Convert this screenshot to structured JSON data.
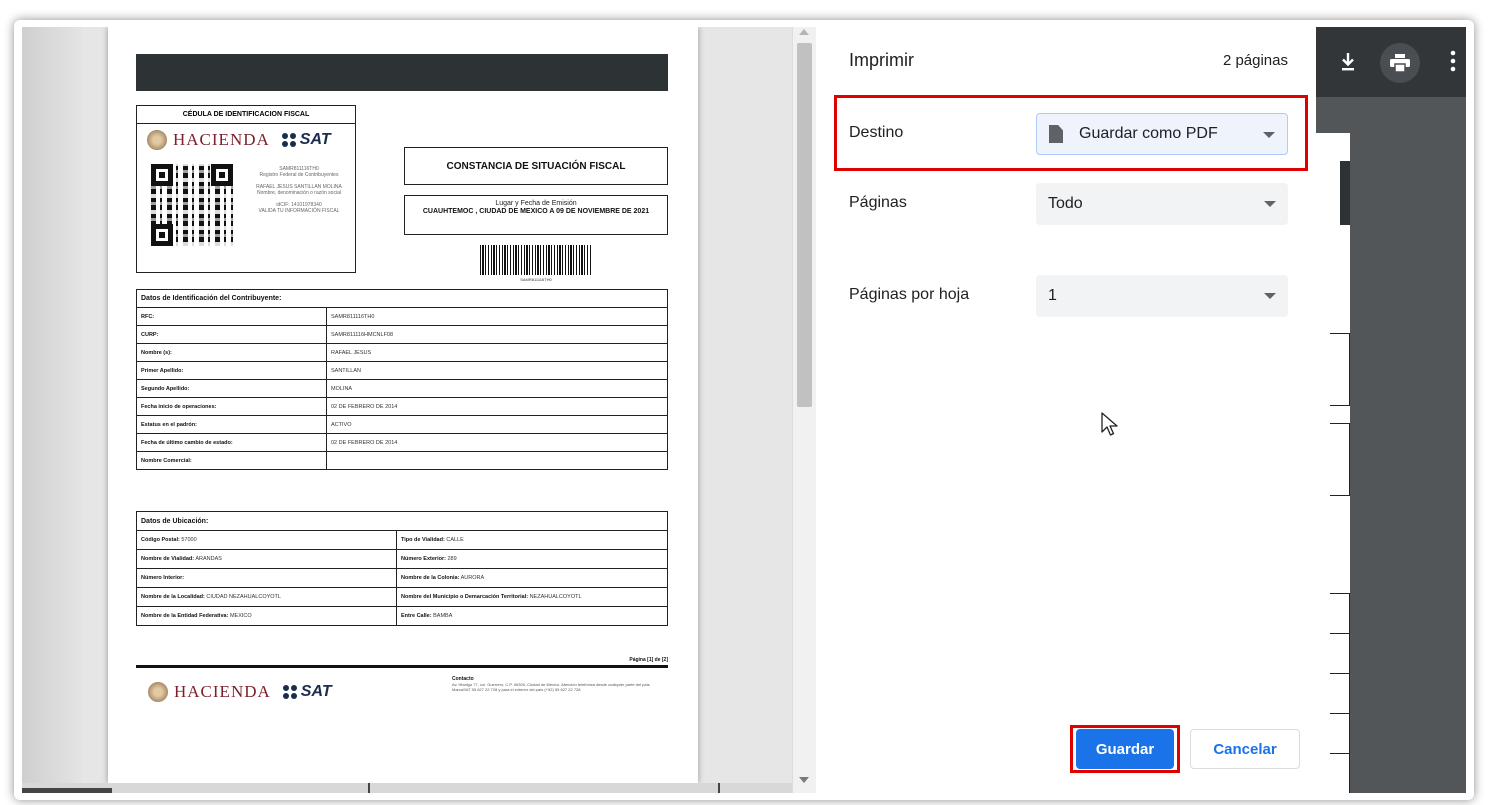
{
  "print_panel": {
    "title": "Imprimir",
    "page_count": "2 páginas",
    "destination_label": "Destino",
    "destination_value": "Guardar como PDF",
    "pages_label": "Páginas",
    "pages_value": "Todo",
    "pages_per_sheet_label": "Páginas por hoja",
    "pages_per_sheet_value": "1",
    "save_button": "Guardar",
    "cancel_button": "Cancelar"
  },
  "document": {
    "cedula_title": "CÉDULA DE IDENTIFICACION FISCAL",
    "hacienda": "HACIENDA",
    "sat": "SAT",
    "rfc_small": "SAMR811116TH0",
    "rfc_caption": "Registro Federal de Contribuyentes",
    "name_small": "RAFAEL JESUS SANTILLAN MOLINA",
    "name_caption": "Nombre, denominación o razón social",
    "idcif": "idCIF: 14101978340",
    "valida": "VALIDA TU INFORMACIÓN FISCAL",
    "constancia_title": "CONSTANCIA DE SITUACIÓN FISCAL",
    "emision_label": "Lugar y Fecha de Emisión",
    "emision_value": "CUAUHTEMOC , CIUDAD DE MEXICO A 09 DE NOVIEMBRE DE 2021",
    "barcode_label": "SAMR811116TH0",
    "ident_heading": "Datos de Identificación del Contribuyente:",
    "ident_rows": [
      {
        "label": "RFC:",
        "value": "SAMR811116TH0"
      },
      {
        "label": "CURP:",
        "value": "SAMR811116HMCNLF08"
      },
      {
        "label": "Nombre (s):",
        "value": "RAFAEL JESUS"
      },
      {
        "label": "Primer Apellido:",
        "value": "SANTILLAN"
      },
      {
        "label": "Segundo Apellido:",
        "value": "MOLINA"
      },
      {
        "label": "Fecha inicio de operaciones:",
        "value": "02 DE FEBRERO DE 2014"
      },
      {
        "label": "Estatus en el padrón:",
        "value": "ACTIVO"
      },
      {
        "label": "Fecha de último cambio de estado:",
        "value": "02 DE FEBRERO DE 2014"
      },
      {
        "label": "Nombre Comercial:",
        "value": ""
      }
    ],
    "ubic_heading": "Datos de Ubicación:",
    "ubic_rows": [
      {
        "left_label": "Código Postal:",
        "left_value": "57000",
        "right_label": "Tipo de Vialidad:",
        "right_value": "CALLE"
      },
      {
        "left_label": "Nombre de Vialidad:",
        "left_value": "ARANDAS",
        "right_label": "Número Exterior:",
        "right_value": "289"
      },
      {
        "left_label": "Número Interior:",
        "left_value": "",
        "right_label": "Nombre de la Colonia:",
        "right_value": "AURORA"
      },
      {
        "left_label": "Nombre de la Localidad:",
        "left_value": "CIUDAD NEZAHUALCOYOTL",
        "right_label": "Nombre del Municipio o Demarcación Territorial:",
        "right_value": "NEZAHUALCOYOTL"
      },
      {
        "left_label": "Nombre de la Entidad Federativa:",
        "left_value": "MEXICO",
        "right_label": "Entre Calle:",
        "right_value": "BAMBA"
      }
    ],
    "page_indicator": "Página [1] de [2]",
    "contact_title": "Contacto",
    "contact_text": "Av. Hidalgo 77, col. Guerrero, C.P. 06300, Ciudad de México. Atención telefónica desde cualquier parte del país MarcaSAT 55 627 22 728 y para el exterior del país (+52) 55 627 22 728"
  },
  "toolbar": {
    "download_icon": "download-icon",
    "print_icon": "print-icon",
    "more_icon": "more-vert-icon"
  },
  "colors": {
    "accent": "#1a73e8",
    "highlight": "#e00000",
    "toolbar": "#323639"
  }
}
